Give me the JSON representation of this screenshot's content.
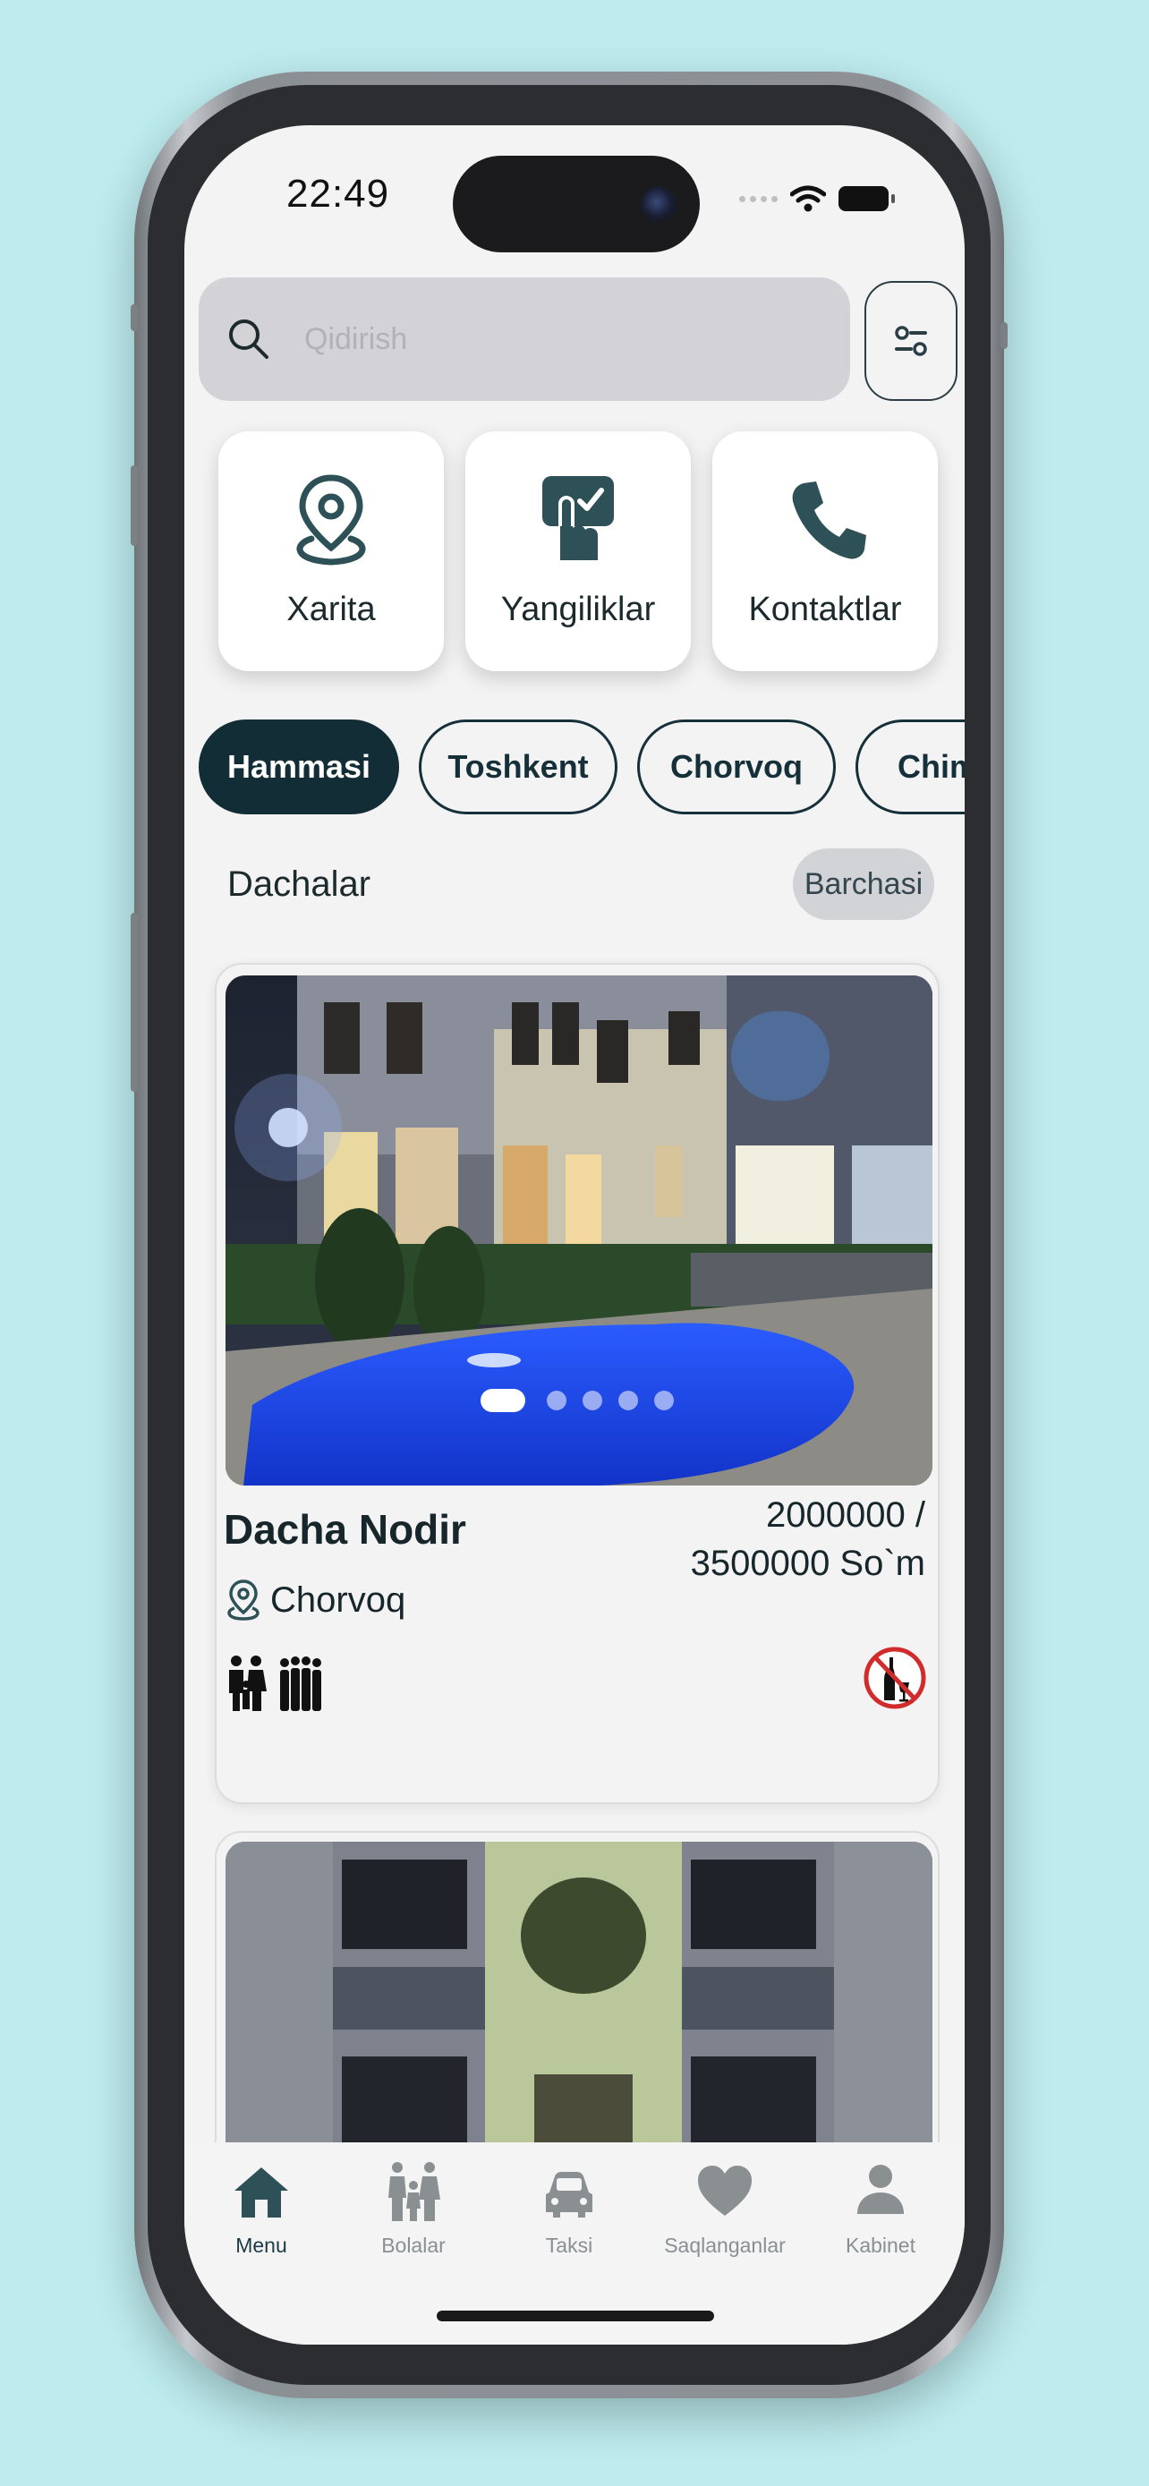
{
  "status_bar": {
    "time": "22:49"
  },
  "search": {
    "placeholder": "Qidirish"
  },
  "quick_actions": [
    {
      "label": "Xarita",
      "icon": "map-pin-icon"
    },
    {
      "label": "Yangiliklar",
      "icon": "news-check-icon"
    },
    {
      "label": "Kontaktlar",
      "icon": "phone-icon"
    }
  ],
  "chips": [
    {
      "label": "Hammasi",
      "selected": true
    },
    {
      "label": "Toshkent",
      "selected": false
    },
    {
      "label": "Chorvoq",
      "selected": false
    },
    {
      "label": "Chim",
      "selected": false
    }
  ],
  "section": {
    "title": "Dachalar",
    "see_all": "Barchasi"
  },
  "listings": [
    {
      "name": "Dacha Nodir",
      "price_line1": "2000000 /",
      "price_line2": "3500000 So`m",
      "location": "Chorvoq",
      "tags": [
        "family-icon",
        "group-icon"
      ],
      "restriction": "no-alcohol-icon",
      "photo": "house-pool-photo",
      "carousel": {
        "count": 5,
        "active": 0
      }
    },
    {
      "photo": "building-facade-photo"
    }
  ],
  "tabbar": {
    "items": [
      {
        "label": "Menu",
        "icon": "home-icon",
        "active": true
      },
      {
        "label": "Bolalar",
        "icon": "family-icon",
        "active": false
      },
      {
        "label": "Taksi",
        "icon": "car-icon",
        "active": false
      },
      {
        "label": "Saqlanganlar",
        "icon": "heart-icon",
        "active": false
      },
      {
        "label": "Kabinet",
        "icon": "person-icon",
        "active": false
      }
    ]
  },
  "colors": {
    "background": "#bdebee",
    "primary": "#132d37",
    "tile_icon": "#2d5157",
    "inactive_tab": "#8a8f92",
    "no_alcohol": "#d22b2b"
  }
}
